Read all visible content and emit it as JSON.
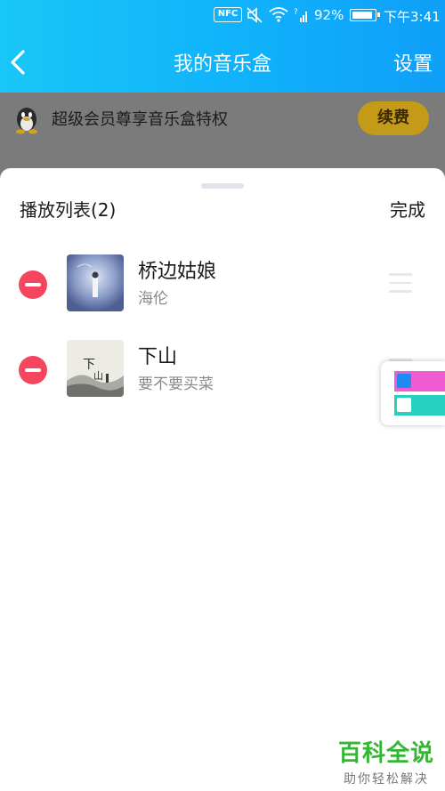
{
  "status_bar": {
    "nfc": "NFC",
    "battery_percent": "92%",
    "battery_level": 0.92,
    "time": "下午3:41"
  },
  "nav": {
    "title": "我的音乐盒",
    "settings_label": "设置"
  },
  "vip_banner": {
    "text": "超级会员尊享音乐盒特权",
    "renew_label": "续费"
  },
  "playlist": {
    "title": "播放列表(2)",
    "done_label": "完成",
    "items": [
      {
        "song": "桥边姑娘",
        "artist": "海伦"
      },
      {
        "song": "下山",
        "artist": "要不要买菜"
      }
    ]
  },
  "watermark": {
    "title": "百科全说",
    "subtitle": "助你轻松解决"
  },
  "colors": {
    "accent": "#10b4fb",
    "remove": "#f5455f",
    "renew": "#c49a19",
    "watermark": "#33b633"
  }
}
